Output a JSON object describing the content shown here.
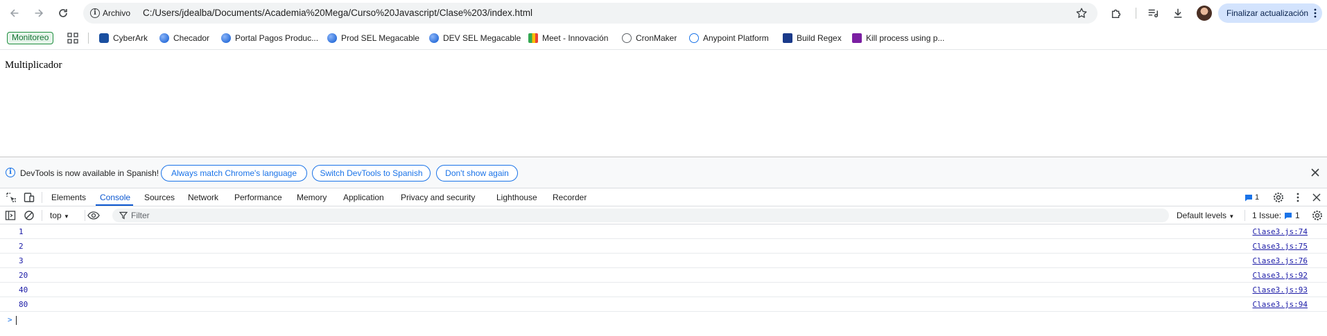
{
  "browser": {
    "chip_label": "Archivo",
    "url": "C:/Users/jdealba/Documents/Academia%20Mega/Curso%20Javascript/Clase%203/index.html",
    "update_button": "Finalizar actualización"
  },
  "bookmarks": {
    "monitoreo": "Monitoreo",
    "items": [
      {
        "label": "CyberArk",
        "color": "#1a4fa0"
      },
      {
        "label": "Checador",
        "color": "#0b57d0"
      },
      {
        "label": "Portal Pagos Produc...",
        "color": "#0b57d0"
      },
      {
        "label": "Prod SEL Megacable",
        "color": "#0b57d0"
      },
      {
        "label": "DEV SEL Megacable",
        "color": "#0b57d0"
      },
      {
        "label": "Meet - Innovación",
        "color": "#34a853"
      },
      {
        "label": "CronMaker",
        "color": "#5f6368"
      },
      {
        "label": "Anypoint Platform",
        "color": "#1a73e8"
      },
      {
        "label": "Build Regex",
        "color": "#1a3a8a"
      },
      {
        "label": "Kill process using p...",
        "color": "#7b1fa2"
      }
    ]
  },
  "page": {
    "text": "Multiplicador"
  },
  "devtools": {
    "infobar": {
      "message": "DevTools is now available in Spanish!",
      "btn_match": "Always match Chrome's language",
      "btn_switch": "Switch DevTools to Spanish",
      "btn_dont": "Don't show again"
    },
    "tabs": [
      "Elements",
      "Console",
      "Sources",
      "Network",
      "Performance",
      "Memory",
      "Application",
      "Privacy and security",
      "Lighthouse",
      "Recorder"
    ],
    "active_tab": "Console",
    "issues_badge": "1",
    "console": {
      "context": "top",
      "filter_placeholder": "Filter",
      "levels": "Default levels",
      "issues_label": "1 Issue:",
      "issues_count": "1",
      "logs": [
        {
          "value": "1",
          "source": "Clase3.js:74"
        },
        {
          "value": "2",
          "source": "Clase3.js:75"
        },
        {
          "value": "3",
          "source": "Clase3.js:76"
        },
        {
          "value": "20",
          "source": "Clase3.js:92"
        },
        {
          "value": "40",
          "source": "Clase3.js:93"
        },
        {
          "value": "80",
          "source": "Clase3.js:94"
        }
      ],
      "prompt": ">"
    }
  },
  "colors": {
    "accent": "#0b57d0",
    "log_text": "#1a1aa6"
  }
}
